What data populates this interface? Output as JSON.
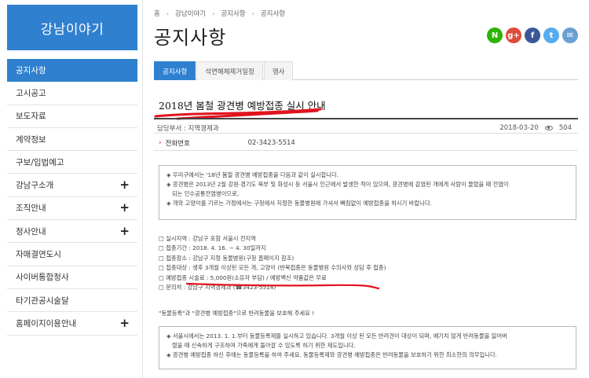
{
  "sidebar": {
    "logo": "강남이야기",
    "items": [
      {
        "label": "공지사항",
        "active": true,
        "expandable": false
      },
      {
        "label": "고시공고",
        "active": false,
        "expandable": false
      },
      {
        "label": "보도자료",
        "active": false,
        "expandable": false
      },
      {
        "label": "계약정보",
        "active": false,
        "expandable": false
      },
      {
        "label": "구보/입법예고",
        "active": false,
        "expandable": false
      },
      {
        "label": "강남구소개",
        "active": false,
        "expandable": true
      },
      {
        "label": "조직안내",
        "active": false,
        "expandable": true
      },
      {
        "label": "청사안내",
        "active": false,
        "expandable": true
      },
      {
        "label": "자매결연도시",
        "active": false,
        "expandable": false
      },
      {
        "label": "사이버통합청사",
        "active": false,
        "expandable": false
      },
      {
        "label": "타기관공시술달",
        "active": false,
        "expandable": false
      },
      {
        "label": "홈페이지이용안내",
        "active": false,
        "expandable": true
      }
    ],
    "expand_symbol": "+"
  },
  "breadcrumb": {
    "home": "홈",
    "level1": "강남이야기",
    "level2": "공지사항",
    "level3": "공지사항",
    "separator": "›"
  },
  "page_title": "공지사항",
  "share": {
    "naver": "N",
    "google": "g+",
    "facebook": "f",
    "twitter": "t",
    "mail": "✉"
  },
  "tabs": [
    {
      "label": "공지사항",
      "active": true
    },
    {
      "label": "석면해체제거일정",
      "active": false
    },
    {
      "label": "행사",
      "active": false
    }
  ],
  "post": {
    "title": "2018년 봄철 광견병 예방접종 실시 안내",
    "department": "담당부서 : 지역경제과",
    "date": "2018-03-20",
    "views": "504",
    "phone_label": "전화번호",
    "phone_value": "02-3423-5514"
  },
  "notice1": [
    "◈ 우리구에서는 '18년 봄철 광견병 예방접종을 다음과 같이 실시합니다.",
    "◈ 광견병은 2013년 2월 강원·경기도 북부 및 화성시 등 서울시 인근에서 발생한 적이 있으며, 광견병에 감염된 개에게 사람이 물렸을 때 전염이",
    "   되는 인수공통전염병이므로,",
    "◈ 개와 고양이를 기르는 가정에서는 구청에서 지정한 동물병원에 가셔서 빠짐없이 예방접종을 하시기 바랍니다."
  ],
  "details": [
    "실시지역 : 강남구 포함 서울시 전지역",
    "접종기간 : 2018. 4. 16. ~ 4. 30일까지",
    "접종장소 : 강남구 지정 동물병원(구청 홈페이지 참조)",
    "접종대상 : 생후 3개월 이상된 모든 개, 고양이 (반복접종은 동물병원 수의사와 상담 후 접종)",
    "예방접종 시술료 : 5,000원(소유자 부담) / 예방백신 약품값은 무료",
    "문의처 : 강남구 지역경제과 (☎3423-5514)"
  ],
  "foot_note": "\"동물등록\"과 \"광견병 예방접종\"으로 반려동물을 보호해 주세요 !",
  "notice2": [
    "◈ 서울시에서는 2013. 1. 1.부터 동물등록제를 실시하고 있습니다. 3개월 이상 된 모든 반려견이 대상이 되며, 예기치 않게 반려동물을 잃어버",
    "   렸을 때 신속하게 구조하여 가족에게 돌아갈 수 있도록 하기 위한 제도입니다.",
    "◈ 광견병 예방접종 하신 후에는 동물등록을 하여 주세요. 동물등록제와 광견병 예방접종은 반려동물을 보호하기 위한 최소한의 의무입니다."
  ],
  "colors": {
    "primary": "#2f80cf",
    "annotation_red": "#e0141e"
  }
}
